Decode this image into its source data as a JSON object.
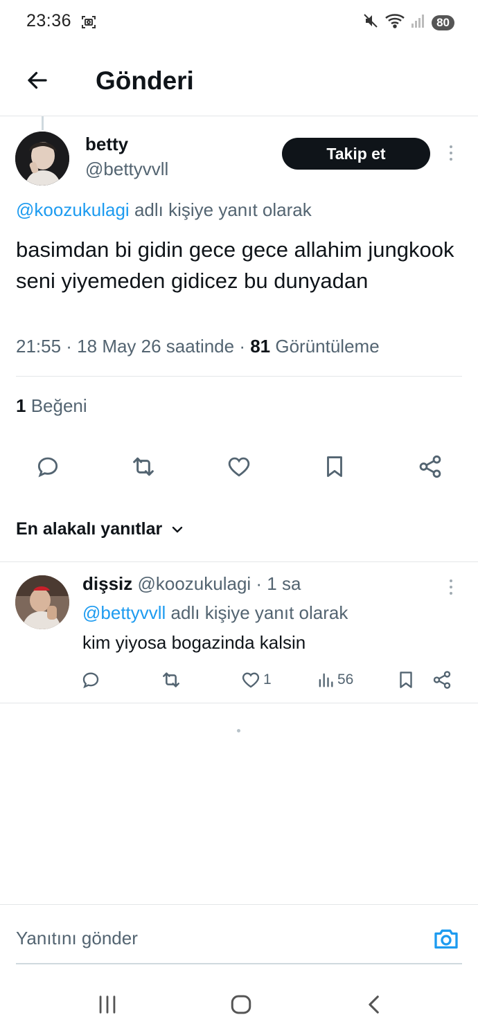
{
  "status_bar": {
    "time": "23:36",
    "battery": "80",
    "icons": [
      "screenshot-icon",
      "mute-icon",
      "wifi-icon",
      "signal-icon"
    ]
  },
  "header": {
    "title": "Gönderi",
    "back_icon": "arrow-left-icon"
  },
  "tweet": {
    "author_name": "betty",
    "author_handle": "@bettyvvll",
    "follow_label": "Takip et",
    "reply_to_handle": "@koozukulagi",
    "reply_to_suffix": " adlı kişiye yanıt olarak",
    "text": "basimdan bi gidin gece gece allahim jungkook seni yiyemeden gidicez bu dunyadan",
    "timestamp": "21:55 · 18 May 26 saatinde · ",
    "views_count": "81",
    "views_label": " Görüntüleme",
    "likes_count": "1",
    "likes_label": " Beğeni",
    "actions": [
      "reply-icon",
      "retweet-icon",
      "like-icon",
      "bookmark-icon",
      "share-icon"
    ]
  },
  "replies_section": {
    "sort_label": "En alakalı yanıtlar"
  },
  "reply": {
    "author_name": "dişsiz",
    "author_handle": " @koozukulagi · 1 sa",
    "reply_to_handle": "@bettyvvll",
    "reply_to_suffix": " adlı kişiye yanıt olarak",
    "text": "kim yiyosa bogazinda kalsin",
    "likes": "1",
    "views": "56"
  },
  "compose": {
    "placeholder": "Yanıtını gönder"
  },
  "colors": {
    "accent": "#1d9bf0",
    "text_primary": "#0f1419",
    "text_secondary": "#536471",
    "divider": "#e4e6e8"
  }
}
